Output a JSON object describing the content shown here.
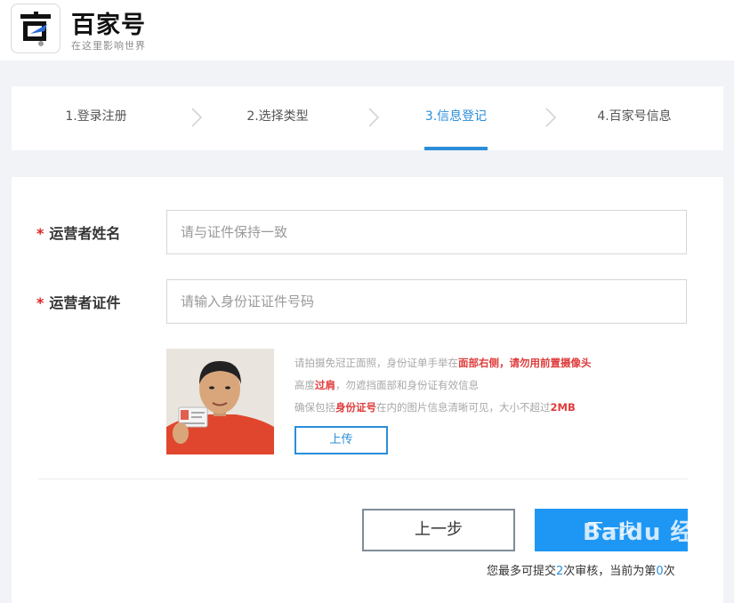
{
  "header": {
    "brand_name": "百家号",
    "slogan": "在这里影响世界"
  },
  "steps": [
    {
      "label": "1.登录注册",
      "active": false
    },
    {
      "label": "2.选择类型",
      "active": false
    },
    {
      "label": "3.信息登记",
      "active": true
    },
    {
      "label": "4.百家号信息",
      "active": false
    }
  ],
  "form": {
    "required_mark": "*",
    "operator_name": {
      "label": "运营者姓名",
      "value": "",
      "placeholder": "请与证件保持一致"
    },
    "operator_id": {
      "label": "运营者证件",
      "value": "",
      "placeholder": "请输入身份证证件号码"
    },
    "photo_tips": {
      "line1_a": "请拍摄免冠正面照，身份证单手举在",
      "line1_b": "面部右侧，请勿用前置摄像头",
      "line2_a": "高度",
      "line2_b": "过肩",
      "line2_c": "，勿遮挡面部和身份证有效信息",
      "line3_a": "确保包括",
      "line3_b": "身份证号",
      "line3_c": "在内的图片信息清晰可见，大小不超过",
      "line3_d": "2MB"
    },
    "upload_label": "上传"
  },
  "actions": {
    "prev_label": "上一步",
    "next_label": "下一步",
    "note_a": "您最多可提交",
    "note_max": "2",
    "note_b": "次审核，当前为第",
    "note_current": "0",
    "note_c": "次"
  },
  "watermark": "Baidu 经验",
  "colors": {
    "accent": "#2b8ed8",
    "next_button": "#1e97f4",
    "required": "#e02020",
    "highlight": "#e03c3c"
  }
}
